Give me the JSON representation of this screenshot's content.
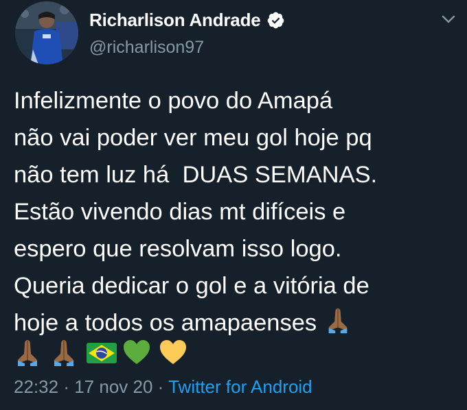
{
  "author": {
    "display_name": "Richarlison Andrade",
    "handle": "@richarlison97",
    "verified": true
  },
  "tweet": {
    "lines": [
      "Infelizmente o povo do Amapá",
      "não vai poder ver meu gol hoje pq",
      "não tem luz há  DUAS SEMANAS.",
      "Estão vivendo dias mt difíceis e",
      "espero que resolvam isso logo.",
      "Queria dedicar o gol e a vitória de",
      "hoje a todos os amapaenses"
    ],
    "emojis": [
      "praying-hands",
      "praying-hands",
      "praying-hands",
      "brazil-flag",
      "green-heart",
      "yellow-heart"
    ]
  },
  "meta": {
    "time": "22:32",
    "separator": "·",
    "date": "17 nov 20",
    "source": "Twitter for Android"
  },
  "colors": {
    "background": "#15202b",
    "secondary_text": "#8899a6",
    "link": "#1da1f2",
    "verified_badge": "#ffffff"
  }
}
